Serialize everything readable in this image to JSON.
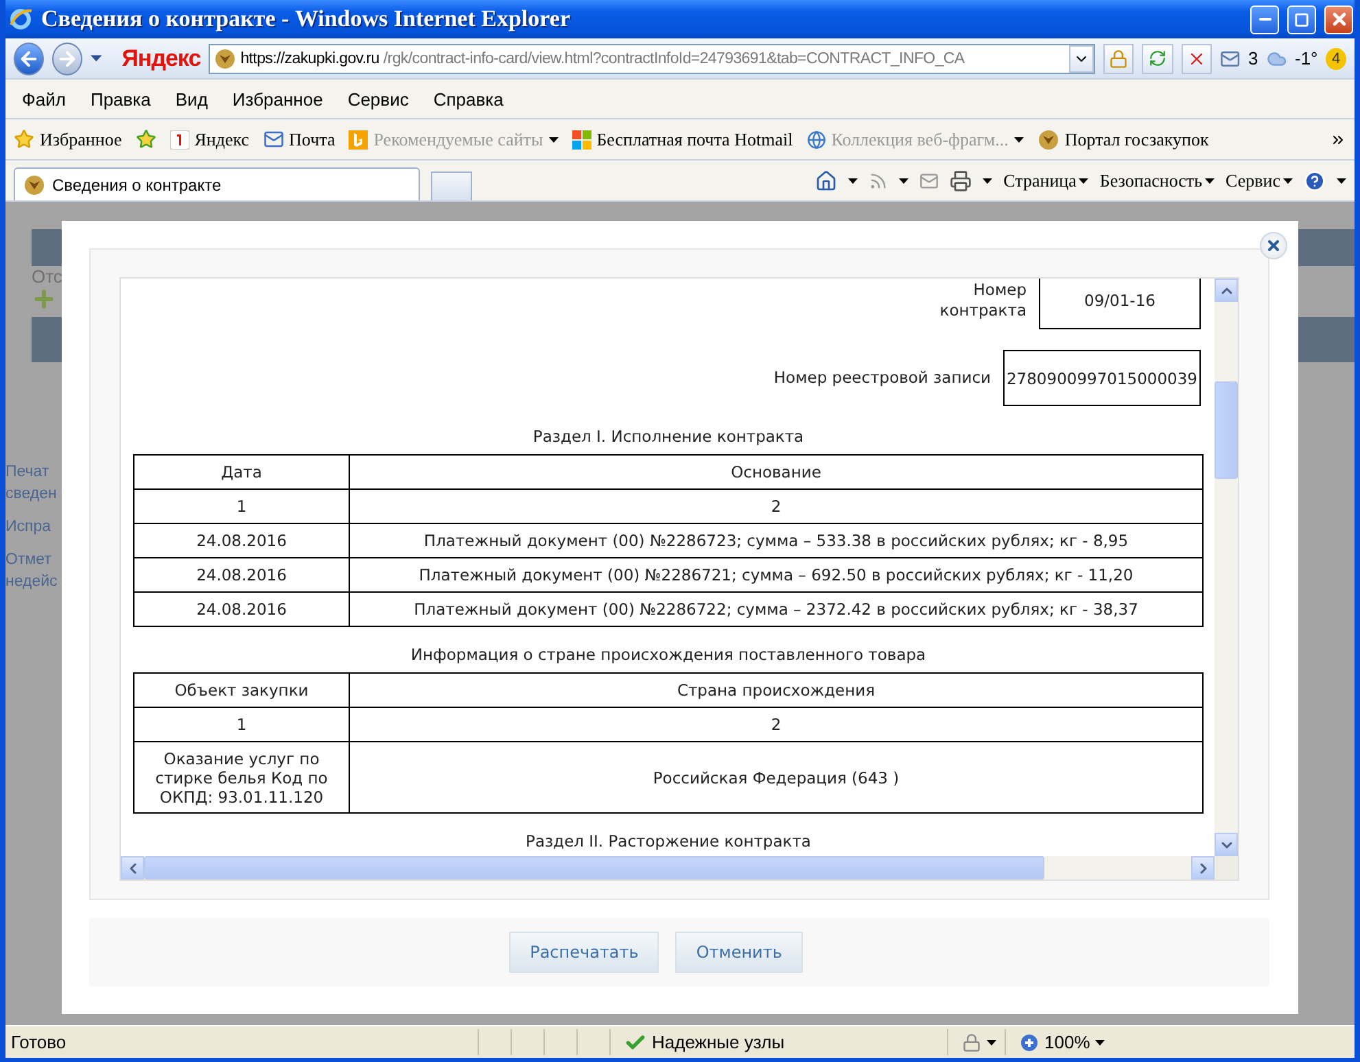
{
  "window": {
    "title": "Сведения о контракте - Windows Internet Explorer"
  },
  "address_bar": {
    "brand": "Яндекс",
    "url_host": "https://zakupki.gov.ru",
    "url_path": "/rgk/contract-info-card/view.html?contractInfoId=24793691&tab=CONTRACT_INFO_CA",
    "mail_count": "3",
    "temperature": "-1°",
    "notification_count": "4"
  },
  "menu": [
    "Файл",
    "Правка",
    "Вид",
    "Избранное",
    "Сервис",
    "Справка"
  ],
  "favorites_button": {
    "label": "Избранное"
  },
  "favorites": [
    {
      "kind": "yandex",
      "label": "Яндекс",
      "disabled": false,
      "dropdown": false
    },
    {
      "kind": "mail",
      "label": "Почта",
      "disabled": false,
      "dropdown": false
    },
    {
      "kind": "bing",
      "label": "Рекомендуемые сайты",
      "disabled": true,
      "dropdown": true
    },
    {
      "kind": "windows",
      "label": "Бесплатная почта Hotmail",
      "disabled": false,
      "dropdown": false
    },
    {
      "kind": "page",
      "label": "Коллекция веб-фрагм...",
      "disabled": true,
      "dropdown": true
    },
    {
      "kind": "emblem",
      "label": "Портал госзакупок",
      "disabled": false,
      "dropdown": false
    }
  ],
  "tabs": [
    {
      "label": "Сведения о контракте",
      "selected": true
    }
  ],
  "command_bar": [
    "Страница",
    "Безопасность",
    "Сервис"
  ],
  "background_page": {
    "heading": "Отс",
    "sidebar_links": [
      {
        "lines": [
          "Печат",
          "сведен"
        ]
      },
      {
        "lines": [
          "Испра"
        ]
      },
      {
        "lines": [
          "Отмет",
          "недейс"
        ]
      }
    ]
  },
  "dialog": {
    "contract_number": {
      "label": "Номер контракта",
      "value": "09/01-16"
    },
    "registry_number": {
      "label": "Номер реестровой записи",
      "value": "2780900997015000039"
    },
    "execution": {
      "title": "Раздел I. Исполнение контракта",
      "columns": [
        "Дата",
        "Основание"
      ],
      "column_numbers": [
        "1",
        "2"
      ],
      "rows": [
        [
          "24.08.2016",
          "Платежный документ (00) №2286723; сумма – 533.38 в российских рублях; кг - 8,95"
        ],
        [
          "24.08.2016",
          "Платежный документ (00) №2286721; сумма – 692.50 в российских рублях; кг - 11,20"
        ],
        [
          "24.08.2016",
          "Платежный документ (00) №2286722; сумма – 2372.42 в российских рублях; кг - 38,37"
        ]
      ]
    },
    "origin": {
      "title": "Информация о стране происхождения поставленного товара",
      "columns": [
        "Объект закупки",
        "Страна происхождения"
      ],
      "column_numbers": [
        "1",
        "2"
      ],
      "rows": [
        [
          "Оказание услуг по стирке белья Код по ОКПД: 93.01.11.120",
          "Российская Федерация (643 )"
        ]
      ]
    },
    "termination_title": "Раздел II. Расторжение контракта",
    "buttons": [
      "Распечатать",
      "Отменить"
    ]
  },
  "status_bar": {
    "text": "Готово",
    "zone": "Надежные узлы",
    "zoom": "100%"
  }
}
